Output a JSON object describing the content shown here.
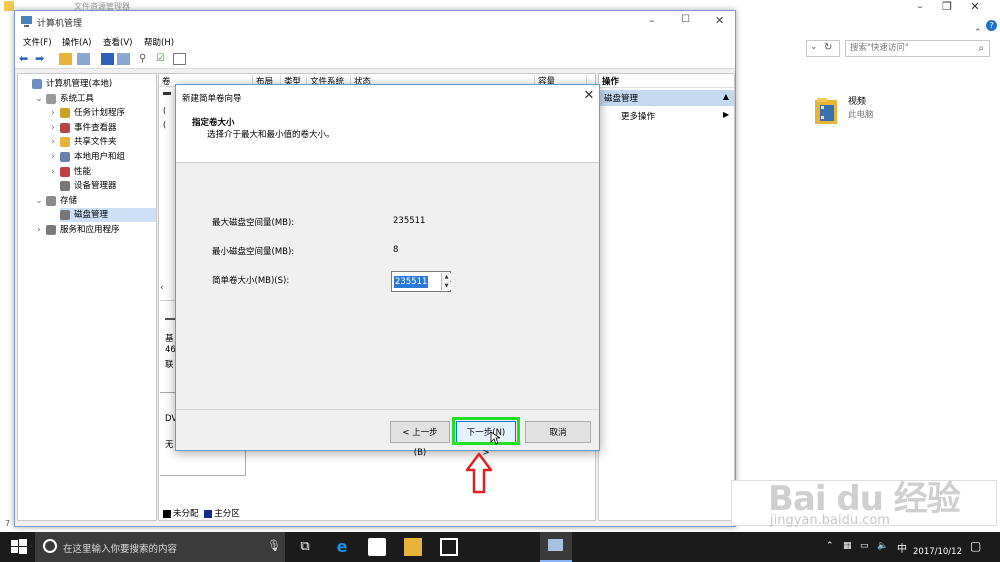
{
  "explorer": {
    "title": "文件资源管理器",
    "search_placeholder": "搜索\"快速访问\"",
    "folder": {
      "name": "视频",
      "location": "此电脑"
    }
  },
  "computer_management": {
    "title": "计算机管理",
    "menu": [
      "文件(F)",
      "操作(A)",
      "查看(V)",
      "帮助(H)"
    ],
    "tree": [
      {
        "label": "计算机管理(本地)",
        "level": 0,
        "icon": "computer-icon"
      },
      {
        "label": "系统工具",
        "level": 1,
        "expander": "⌄",
        "icon": "tools-icon"
      },
      {
        "label": "任务计划程序",
        "level": 2,
        "expander": "›",
        "icon": "clock-icon"
      },
      {
        "label": "事件查看器",
        "level": 2,
        "expander": "›",
        "icon": "event-viewer-icon"
      },
      {
        "label": "共享文件夹",
        "level": 2,
        "expander": "›",
        "icon": "shared-folder-icon"
      },
      {
        "label": "本地用户和组",
        "level": 2,
        "expander": "›",
        "icon": "users-icon"
      },
      {
        "label": "性能",
        "level": 2,
        "expander": "›",
        "icon": "performance-icon"
      },
      {
        "label": "设备管理器",
        "level": 2,
        "expander": "",
        "icon": "device-manager-icon"
      },
      {
        "label": "存储",
        "level": 1,
        "expander": "⌄",
        "icon": "storage-icon"
      },
      {
        "label": "磁盘管理",
        "level": 2,
        "expander": "",
        "icon": "disk-icon",
        "selected": true
      },
      {
        "label": "服务和应用程序",
        "level": 1,
        "expander": "›",
        "icon": "services-icon"
      }
    ],
    "volume_columns": [
      "卷",
      "布局",
      "类型",
      "文件系统",
      "状态",
      "容量"
    ],
    "disk_fragments": [
      "基",
      "46",
      "联",
      "DV",
      "无"
    ],
    "legend": [
      {
        "label": "未分配",
        "color": "#000000"
      },
      {
        "label": "主分区",
        "color": "#1a2a8a"
      }
    ],
    "actions": {
      "header": "操作",
      "section": "磁盘管理",
      "more": "更多操作"
    }
  },
  "wizard": {
    "title": "新建简单卷向导",
    "heading": "指定卷大小",
    "subheading": "选择介于最大和最小值的卷大小。",
    "max_label": "最大磁盘空间量(MB):",
    "max_value": "235511",
    "min_label": "最小磁盘空间量(MB):",
    "min_value": "8",
    "size_label": "简单卷大小(MB)(S):",
    "size_value": "235511",
    "back_label": "< 上一步(B)",
    "next_label": "下一步(N) >",
    "cancel_label": "取消"
  },
  "watermark": {
    "logo": "Bai du 经验",
    "url": "jingyan.baidu.com"
  },
  "taskbar": {
    "search_placeholder": "在这里输入你要搜索的内容",
    "ime": "中",
    "date": "2017/10/12"
  },
  "colors": {
    "next_highlight": "#22e022",
    "arrow": "#e02020",
    "selection": "#c4d8f0",
    "taskbar": "#1b1b1b"
  }
}
